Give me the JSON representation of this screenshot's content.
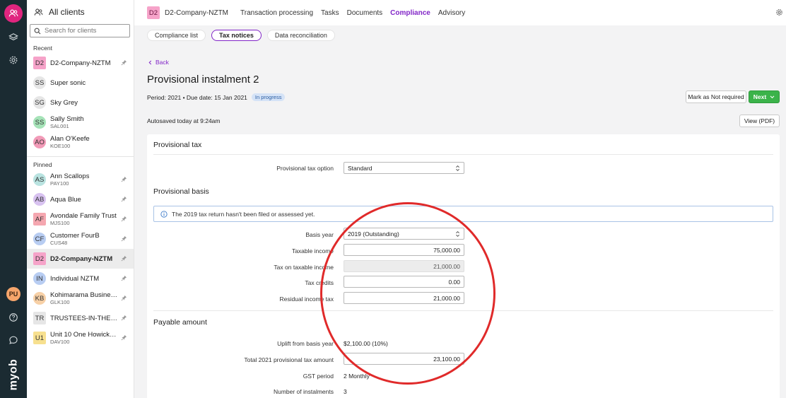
{
  "rail": {
    "brand": "myob",
    "user_initials": "PU"
  },
  "sidebar": {
    "header": "All clients",
    "search_placeholder": "Search for clients",
    "recent_label": "Recent",
    "pinned_label": "Pinned",
    "recent": [
      {
        "initials": "D2",
        "name": "D2-Company-NZTM",
        "code": "",
        "color": "#f6a3c9",
        "pinned": true
      },
      {
        "initials": "SS",
        "name": "Super sonic",
        "code": "",
        "color": "#e6e6e6",
        "pinned": false
      },
      {
        "initials": "SG",
        "name": "Sky Grey",
        "code": "",
        "color": "#e6e6e6",
        "pinned": false
      },
      {
        "initials": "SS",
        "name": "Sally Smith",
        "code": "SAL001",
        "color": "#a6e3b8",
        "pinned": false
      },
      {
        "initials": "AO",
        "name": "Alan O'Keefe",
        "code": "KOE100",
        "color": "#f29bb8",
        "pinned": false
      }
    ],
    "pinned": [
      {
        "initials": "AS",
        "name": "Ann Scallops",
        "code": "PAY100",
        "color": "#b9e3e0",
        "pinned": true
      },
      {
        "initials": "AB",
        "name": "Aqua Blue",
        "code": "",
        "color": "#d8c2f0",
        "pinned": true
      },
      {
        "initials": "AF",
        "name": "Avondale Family Trust",
        "code": "MJS100",
        "color": "#f5a7b0",
        "pinned": true
      },
      {
        "initials": "CF",
        "name": "Customer FourB",
        "code": "CUS48",
        "color": "#b8cdf2",
        "pinned": true
      },
      {
        "initials": "D2",
        "name": "D2-Company-NZTM",
        "code": "",
        "color": "#f6a3c9",
        "pinned": true,
        "selected": true
      },
      {
        "initials": "IN",
        "name": "Individual NZTM",
        "code": "",
        "color": "#b8cdf2",
        "pinned": true
      },
      {
        "initials": "KB",
        "name": "Kohimarama Business ...",
        "code": "GLK100",
        "color": "#f7d0a6",
        "pinned": true
      },
      {
        "initials": "TR",
        "name": "TRUSTEES-IN-THE-DH...",
        "code": "",
        "color": "#e6e6e6",
        "pinned": true
      },
      {
        "initials": "U1",
        "name": "Unit 10 One Howick Li...",
        "code": "DAV100",
        "color": "#f7e08f",
        "pinned": true
      }
    ]
  },
  "topnav": {
    "client_initials": "D2",
    "client_name": "D2-Company-NZTM",
    "items": [
      "Transaction processing",
      "Tasks",
      "Documents",
      "Compliance",
      "Advisory"
    ],
    "active": "Compliance"
  },
  "subtabs": [
    "Compliance list",
    "Tax notices",
    "Data reconciliation"
  ],
  "active_subtab": "Tax notices",
  "page": {
    "back": "Back",
    "title": "Provisional instalment 2",
    "meta": "Period: 2021 • Due date: 15 Jan 2021",
    "status": "In progress",
    "btn_not_required": "Mark as Not required",
    "btn_next": "Next",
    "autosaved": "Autosaved today at 9:24am",
    "btn_view_pdf": "View (PDF)"
  },
  "form": {
    "provisional_tax_title": "Provisional tax",
    "option_label": "Provisional tax option",
    "option_value": "Standard",
    "basis_title": "Provisional basis",
    "info_text": "The 2019 tax return hasn't been filed or assessed yet.",
    "basis_year_label": "Basis year",
    "basis_year_value": "2019 (Outstanding)",
    "taxable_income_label": "Taxable income",
    "taxable_income_value": "75,000.00",
    "tax_on_income_label": "Tax on taxable income",
    "tax_on_income_value": "21,000.00",
    "tax_credits_label": "Tax credits",
    "tax_credits_value": "0.00",
    "residual_label": "Residual income tax",
    "residual_value": "21,000.00",
    "payable_title": "Payable amount",
    "uplift_label": "Uplift from basis year",
    "uplift_value": "$2,100.00 (10%)",
    "total_label": "Total 2021 provisional tax amount",
    "total_value": "23,100.00",
    "gst_label": "GST period",
    "gst_value": "2 Monthly",
    "instalments_label": "Number of instalments",
    "instalments_value": "3"
  },
  "colors": {
    "accent": "#8125c7",
    "brand_pink": "#e0257f",
    "next_green": "#3bb34a",
    "annotation_red": "#e02a2a"
  }
}
